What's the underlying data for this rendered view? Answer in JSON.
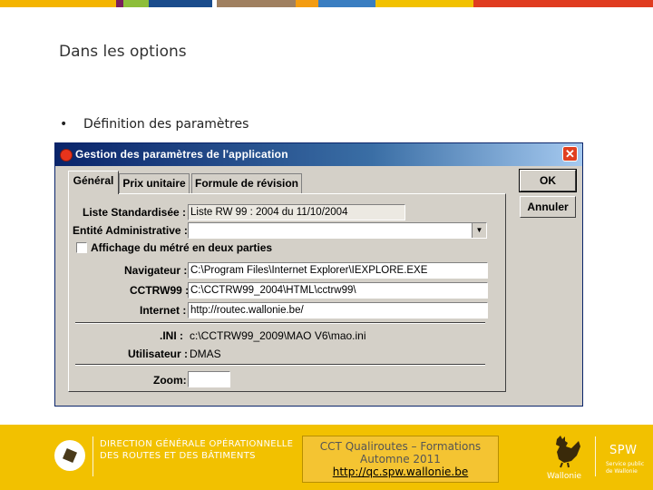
{
  "colors": {
    "topbar": [
      "#f4b400",
      "#7a1f5c",
      "#8dbe3a",
      "#1a4c8c",
      "#ffffff",
      "#a08060",
      "#f39c12",
      "#3a7ec1",
      "#f2c100",
      "#e03c1f"
    ],
    "footer": "#f2c100",
    "dialog_titlebar": "#0a246a"
  },
  "slide": {
    "title": "Dans les options",
    "bullet_char": "•",
    "bullet_text": "Définition des paramètres"
  },
  "dialog": {
    "title": "Gestion des paramètres de l'application",
    "close_icon": "close-icon",
    "close_glyph": "✕",
    "tabs": [
      {
        "label": "Général",
        "active": true
      },
      {
        "label": "Prix unitaire",
        "active": false
      },
      {
        "label": "Formule de révision",
        "active": false
      }
    ],
    "fields": {
      "liste_label": "Liste Standardisée :",
      "liste_value": "Liste RW 99 : 2004 du 11/10/2004",
      "entite_label": "Entité Administrative :",
      "entite_value": "",
      "affichage_label": "Affichage du métré en deux parties",
      "affichage_checked": false,
      "navigateur_label": "Navigateur :",
      "navigateur_value": "C:\\Program Files\\Internet Explorer\\IEXPLORE.EXE",
      "cctrw99_label": "CCTRW99 :",
      "cctrw99_value": "C:\\CCTRW99_2004\\HTML\\cctrw99\\",
      "internet_label": "Internet :",
      "internet_value": "http://routec.wallonie.be/",
      "ini_label": ".INI :",
      "ini_value": "c:\\CCTRW99_2009\\MAO V6\\mao.ini",
      "utilisateur_label": "Utilisateur :",
      "utilisateur_value": "DMAS",
      "zoom_label": "Zoom:",
      "zoom_value": ""
    },
    "buttons": {
      "ok": "OK",
      "annuler": "Annuler"
    }
  },
  "footer": {
    "dgo_line1": "DIRECTION GÉNÉRALE OPÉRATIONNELLE",
    "dgo_line2": "DES ROUTES ET DES BÂTIMENTS",
    "cct_line1": "CCT Qualiroutes – Formations",
    "cct_line2": "Automne 2011",
    "cct_link": "http://qc.spw.wallonie.be",
    "wallonie": "Wallonie",
    "spw": "SPW",
    "spw_sub1": "Service public",
    "spw_sub2": "de Wallonie"
  }
}
